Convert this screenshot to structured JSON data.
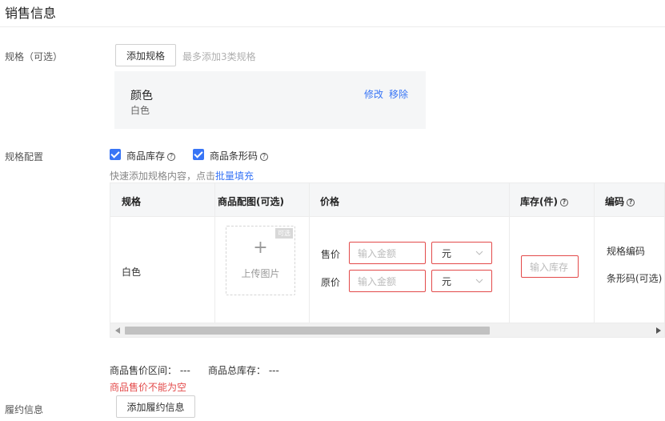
{
  "section_title": "销售信息",
  "spec": {
    "label": "规格（可选）",
    "add_button": "添加规格",
    "hint": "最多添加3类规格",
    "card": {
      "name": "颜色",
      "value": "白色",
      "edit": "修改",
      "remove": "移除"
    }
  },
  "config": {
    "label": "规格配置",
    "check_inventory": "商品库存",
    "check_barcode": "商品条形码",
    "batch_hint": "快速添加规格内容，点击",
    "batch_link": "批量填充"
  },
  "table": {
    "headers": [
      "规格",
      "商品配图(可选)",
      "价格",
      "库存(件)",
      "编码"
    ],
    "row": {
      "spec": "白色",
      "upload_badge": "可选",
      "upload_plus": "+",
      "upload_label": "上传图片",
      "sale_price_label": "售价",
      "orig_price_label": "原价",
      "price_placeholder": "输入金额",
      "unit": "元",
      "stock_placeholder": "输入库存",
      "spec_code": "规格编码",
      "barcode": "条形码(可选)"
    }
  },
  "summary": {
    "price_range_label": "商品售价区间：",
    "price_range_value": "---",
    "total_stock_label": "商品总库存：",
    "total_stock_value": "---",
    "error": "商品售价不能为空"
  },
  "fulfil": {
    "label": "履约信息",
    "button": "添加履约信息"
  },
  "colors": {
    "accent": "#3875f6",
    "error": "#e34a4a"
  }
}
